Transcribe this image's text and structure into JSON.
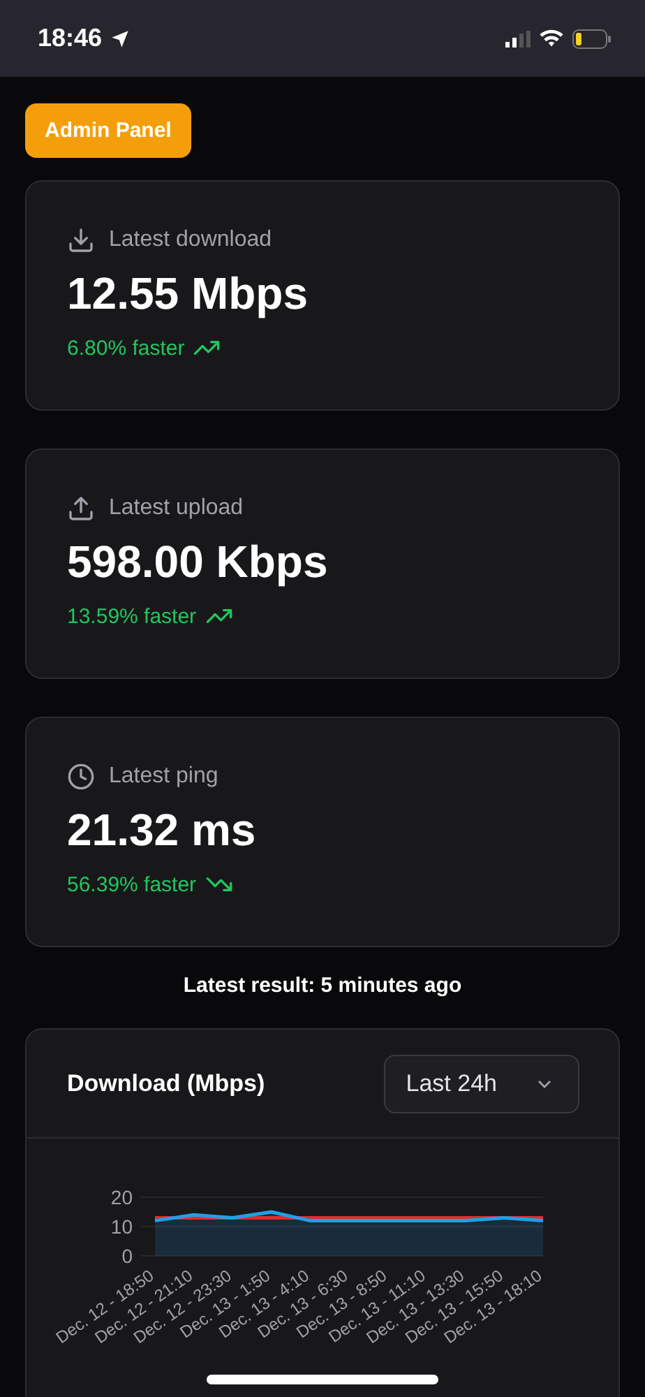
{
  "status_bar": {
    "time": "18:46"
  },
  "admin_button": "Admin Panel",
  "stats": [
    {
      "kind": "download",
      "label": "Latest download",
      "value": "12.55 Mbps",
      "change": "6.80% faster",
      "trend_icon": {
        "kind": "up"
      }
    },
    {
      "kind": "upload",
      "label": "Latest upload",
      "value": "598.00 Kbps",
      "change": "13.59% faster",
      "trend_icon": {
        "kind": "up"
      }
    },
    {
      "kind": "ping",
      "label": "Latest ping",
      "value": "21.32 ms",
      "change": "56.39% faster",
      "trend_icon": {
        "kind": "down"
      }
    }
  ],
  "latest_result": "Latest result: 5 minutes ago",
  "chart_card": {
    "title": "Download (Mbps)",
    "range_select": "Last 24h",
    "chart_data": {
      "type": "area",
      "categories": [
        "Dec. 12 - 18:50",
        "Dec. 12 - 21:10",
        "Dec. 12 - 23:30",
        "Dec. 13 - 1:50",
        "Dec. 13 - 4:10",
        "Dec. 13 - 6:30",
        "Dec. 13 - 8:50",
        "Dec. 13 - 11:10",
        "Dec. 13 - 13:30",
        "Dec. 13 - 15:50",
        "Dec. 13 - 18:10"
      ],
      "series": [
        {
          "type": "area",
          "color": "#1da1e8",
          "values": [
            12,
            14,
            13,
            15,
            12,
            12,
            12,
            12,
            12,
            13,
            12
          ]
        },
        {
          "type": "line",
          "color": "#e52b2b",
          "values": [
            13,
            13,
            13,
            13,
            13,
            13,
            13,
            13,
            13,
            13,
            13
          ]
        }
      ],
      "ylim": [
        0,
        20
      ],
      "yticks": [
        0,
        10,
        20
      ]
    }
  }
}
